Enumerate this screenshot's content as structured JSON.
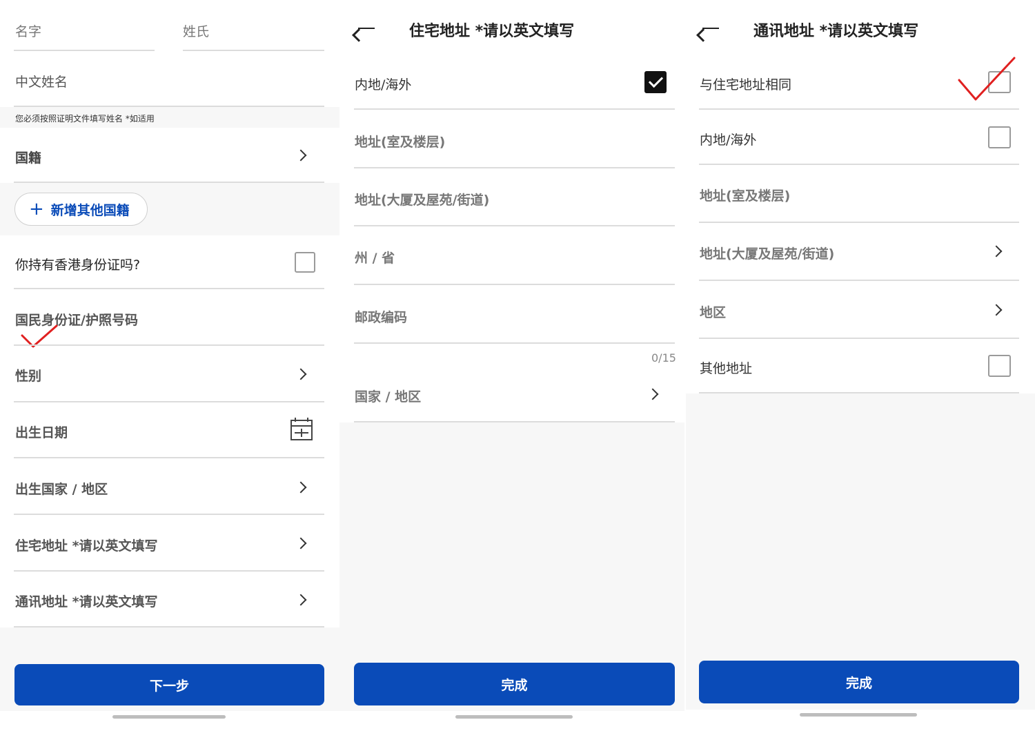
{
  "panel1": {
    "first_name_label": "名字",
    "last_name_label": "姓氏",
    "chinese_name_label": "中文姓名",
    "name_hint": "您必须按照证明文件填写姓名 *如适用",
    "nationality_label": "国籍",
    "add_nationality_label": "新增其他国籍",
    "hk_id_label": "你持有香港身份证吗?",
    "hk_id_checked": false,
    "id_passport_label": "国民身份证/护照号码",
    "gender_label": "性别",
    "dob_label": "出生日期",
    "birth_country_label": "出生国家 / 地区",
    "residential_address_label": "住宅地址 *请以英文填写",
    "correspondence_address_label": "通讯地址 *请以英文填写",
    "next_button": "下一步"
  },
  "panel2": {
    "title": "住宅地址 *请以英文填写",
    "mainland_overseas_label": "内地/海外",
    "mainland_overseas_checked": true,
    "address_room_floor": "地址(室及楼层)",
    "address_building_street": "地址(大厦及屋苑/街道)",
    "state_province": "州 / 省",
    "postal_code": "邮政编码",
    "postal_counter": "0/15",
    "country_region": "国家 / 地区",
    "done_button": "完成"
  },
  "panel3": {
    "title": "通讯地址 *请以英文填写",
    "same_as_residential_label": "与住宅地址相同",
    "same_as_residential_checked": false,
    "mainland_overseas_label": "内地/海外",
    "mainland_overseas_checked": false,
    "address_room_floor": "地址(室及楼层)",
    "address_building_street": "地址(大厦及屋苑/街道)",
    "region": "地区",
    "other_address_label": "其他地址",
    "other_address_checked": false,
    "done_button": "完成"
  },
  "colors": {
    "primary": "#0a4bb8",
    "annotation": "#e02020",
    "divider": "#dcdcdc"
  },
  "icons": [
    "chevron-right-icon",
    "checkbox-icon",
    "plus-icon",
    "calendar-icon",
    "back-arrow-icon",
    "red-check-annotation-icon"
  ]
}
